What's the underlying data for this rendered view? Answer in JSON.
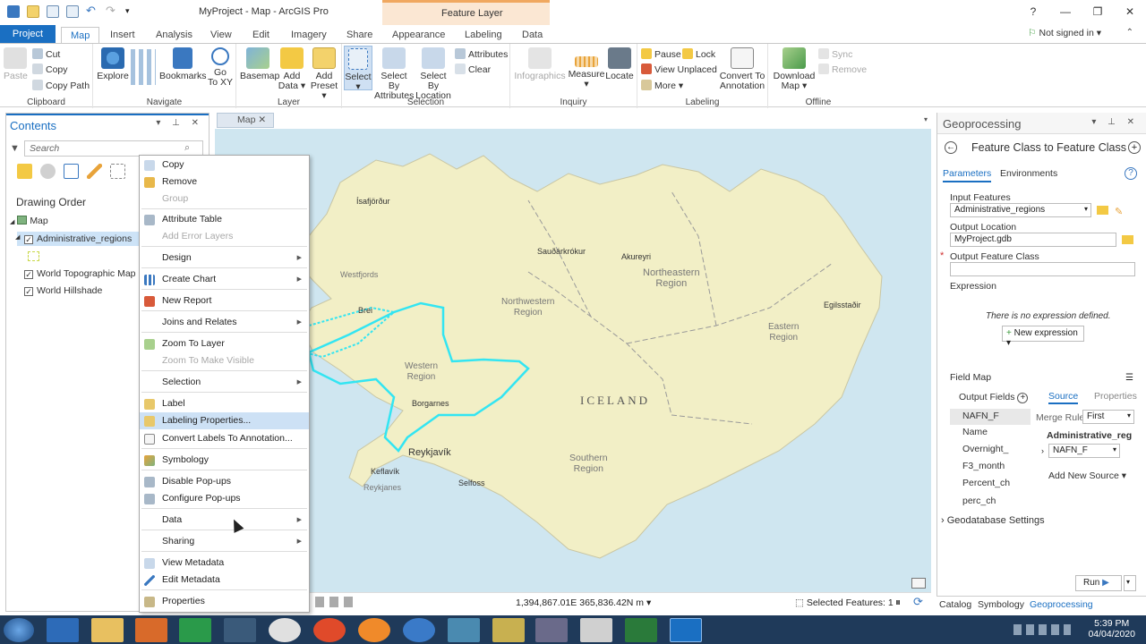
{
  "window": {
    "title": "MyProject - Map - ArcGIS Pro",
    "contextual_header": "Feature Layer",
    "help": "?",
    "minimize": "—",
    "restore": "❐",
    "close": "✕",
    "signin": "Not signed in"
  },
  "tabs": [
    "Project",
    "Map",
    "Insert",
    "Analysis",
    "View",
    "Edit",
    "Imagery",
    "Share",
    "Appearance",
    "Labeling",
    "Data"
  ],
  "ribbon": {
    "clipboard": {
      "label": "Clipboard",
      "paste": "Paste",
      "cut": "Cut",
      "copy": "Copy",
      "copy_path": "Copy Path"
    },
    "navigate": {
      "label": "Navigate",
      "explore": "Explore",
      "bookmarks": "Bookmarks",
      "goto1": "Go",
      "goto2": "To XY"
    },
    "layer": {
      "label": "Layer",
      "basemap": "Basemap",
      "add_data1": "Add",
      "add_data2": "Data",
      "add_preset1": "Add",
      "add_preset2": "Preset"
    },
    "selection": {
      "label": "Selection",
      "select": "Select",
      "sba1": "Select By",
      "sba2": "Attributes",
      "sbl1": "Select By",
      "sbl2": "Location",
      "attributes": "Attributes",
      "clear": "Clear"
    },
    "inquiry": {
      "label": "Inquiry",
      "infographics": "Infographics",
      "measure": "Measure",
      "locate": "Locate"
    },
    "labeling": {
      "label": "Labeling",
      "pause": "Pause",
      "lock": "Lock",
      "view_unplaced": "View Unplaced",
      "more": "More",
      "cta1": "Convert To",
      "cta2": "Annotation"
    },
    "offline": {
      "label": "Offline",
      "dm1": "Download",
      "dm2": "Map",
      "sync": "Sync",
      "remove": "Remove"
    }
  },
  "contents": {
    "title": "Contents",
    "search_placeholder": "Search",
    "drawing_order": "Drawing Order",
    "map": "Map",
    "layers": [
      "Administrative_regions",
      "World Topographic Map",
      "World Hillshade"
    ]
  },
  "context_menu": {
    "items": [
      {
        "label": "Copy",
        "enabled": true
      },
      {
        "label": "Remove",
        "enabled": true
      },
      {
        "label": "Group",
        "enabled": false
      },
      {
        "label": "Attribute Table",
        "enabled": true
      },
      {
        "label": "Add Error Layers",
        "enabled": false
      },
      {
        "label": "Design",
        "enabled": true,
        "submenu": true
      },
      {
        "label": "Create Chart",
        "enabled": true,
        "submenu": true
      },
      {
        "label": "New Report",
        "enabled": true
      },
      {
        "label": "Joins and Relates",
        "enabled": true,
        "submenu": true
      },
      {
        "label": "Zoom To Layer",
        "enabled": true
      },
      {
        "label": "Zoom To Make Visible",
        "enabled": false
      },
      {
        "label": "Selection",
        "enabled": true,
        "submenu": true
      },
      {
        "label": "Label",
        "enabled": true
      },
      {
        "label": "Labeling Properties...",
        "enabled": true,
        "highlighted": true
      },
      {
        "label": "Convert Labels To Annotation...",
        "enabled": true
      },
      {
        "label": "Symbology",
        "enabled": true
      },
      {
        "label": "Disable Pop-ups",
        "enabled": true
      },
      {
        "label": "Configure Pop-ups",
        "enabled": true
      },
      {
        "label": "Data",
        "enabled": true,
        "submenu": true
      },
      {
        "label": "Sharing",
        "enabled": true,
        "submenu": true
      },
      {
        "label": "View Metadata",
        "enabled": true
      },
      {
        "label": "Edit Metadata",
        "enabled": true
      },
      {
        "label": "Properties",
        "enabled": true
      }
    ]
  },
  "map": {
    "tab": "Map",
    "labels": {
      "country": "ICELAND",
      "northeastern1": "Northeastern",
      "northeastern2": "Region",
      "northwestern1": "Northwestern",
      "northwestern2": "Region",
      "eastern1": "Eastern",
      "eastern2": "Region",
      "western1": "Western",
      "western2": "Region",
      "southern1": "Southern",
      "southern2": "Region",
      "isafjordur": "Ísafjörður",
      "westfjords": "Westfjords",
      "saudarkrokur": "Sauðárkrókur",
      "akureyri": "Akureyri",
      "egilsstadir": "Egilsstaðir",
      "borgarnes": "Borgarnes",
      "reykjavik": "Reykjavík",
      "selfoss": "Selfoss",
      "keflavik": "Keflavík",
      "reykjanes": "Reykjanes",
      "broi": "Brei"
    },
    "coordinates": "1,394,867.01E 365,836.42N m",
    "selected_features": "Selected Features: 1"
  },
  "geoprocessing": {
    "title": "Geoprocessing",
    "tool": "Feature Class to Feature Class",
    "tabs": [
      "Parameters",
      "Environments"
    ],
    "input_features_label": "Input Features",
    "input_features": "Administrative_regions",
    "output_location_label": "Output Location",
    "output_location": "MyProject.gdb",
    "output_fc_label": "Output Feature Class",
    "expression_label": "Expression",
    "no_expression": "There is no expression defined.",
    "new_expression": "New expression",
    "field_map": "Field Map",
    "output_fields": "Output Fields",
    "source_tab": "Source",
    "properties_tab": "Properties",
    "fields": [
      "NAFN_F",
      "Name",
      "Overnight_",
      "F3_month",
      "Percent_ch",
      "perc_ch"
    ],
    "merge_rule_label": "Merge Rule",
    "merge_rule": "First",
    "source_layer": "Administrative_reg",
    "source_field": "NAFN_F",
    "add_new_source": "Add New Source",
    "gdb_settings": "Geodatabase Settings",
    "run": "Run"
  },
  "bottom_tabs": [
    "Catalog",
    "Symbology",
    "Geoprocessing"
  ],
  "taskbar": {
    "time": "5:39 PM",
    "date": "04/04/2020"
  }
}
